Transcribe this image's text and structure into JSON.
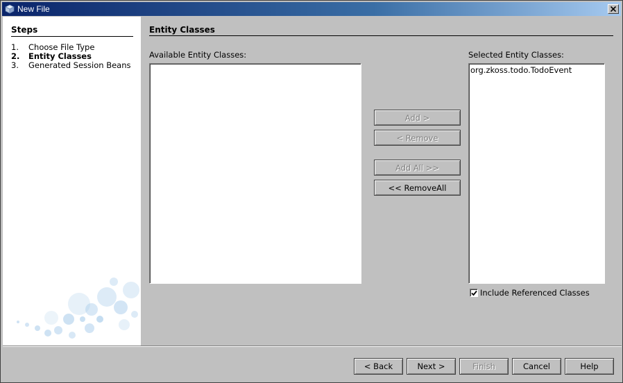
{
  "window": {
    "title": "New File",
    "close_glyph": "✕"
  },
  "steps": {
    "title": "Steps",
    "items": [
      {
        "num": "1.",
        "label": "Choose File Type"
      },
      {
        "num": "2.",
        "label": "Entity Classes"
      },
      {
        "num": "3.",
        "label": "Generated Session Beans"
      }
    ],
    "current_index": 1
  },
  "content": {
    "title": "Entity Classes",
    "available_label": "Available Entity Classes:",
    "available_items": [],
    "selected_label": "Selected Entity Classes:",
    "selected_items": [
      "org.zkoss.todo.TodoEvent"
    ],
    "include_referenced": {
      "label": "Include Referenced Classes",
      "checked": true
    }
  },
  "transfer_buttons": {
    "add": "Add >",
    "remove": "< Remove",
    "add_all": "Add All >>",
    "remove_all": "<< RemoveAll"
  },
  "footer_buttons": {
    "back": "< Back",
    "next": "Next >",
    "finish": "Finish",
    "cancel": "Cancel",
    "help": "Help"
  },
  "colors": {
    "titlebar_start": "#0a246a",
    "titlebar_end": "#a6caf0",
    "dialog_bg": "#c0c0c0",
    "disabled_text": "#808080"
  }
}
